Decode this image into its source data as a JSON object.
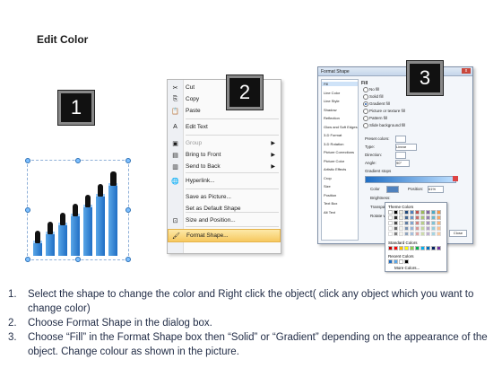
{
  "title": "Edit Color",
  "badges": [
    "1",
    "2",
    "3"
  ],
  "context_menu": {
    "items": [
      {
        "label": "Cut",
        "icon": "scissors-icon",
        "glyph": "✂",
        "disabled": false,
        "submenu": false
      },
      {
        "label": "Copy",
        "icon": "copy-icon",
        "glyph": "⎘",
        "disabled": false,
        "submenu": false
      },
      {
        "label": "Paste",
        "icon": "paste-icon",
        "glyph": "📋",
        "disabled": false,
        "submenu": false
      },
      {
        "label": "Edit Text",
        "icon": "edit-text-icon",
        "glyph": "A",
        "disabled": false,
        "submenu": false
      },
      {
        "label": "Group",
        "icon": "group-icon",
        "glyph": "▣",
        "disabled": true,
        "submenu": true
      },
      {
        "label": "Bring to Front",
        "icon": "bring-to-front-icon",
        "glyph": "▤",
        "disabled": false,
        "submenu": true
      },
      {
        "label": "Send to Back",
        "icon": "send-to-back-icon",
        "glyph": "▥",
        "disabled": false,
        "submenu": true
      },
      {
        "label": "Hyperlink...",
        "icon": "hyperlink-icon",
        "glyph": "🌐",
        "disabled": false,
        "submenu": false
      },
      {
        "label": "Save as Picture...",
        "icon": "",
        "glyph": "",
        "disabled": false,
        "submenu": false
      },
      {
        "label": "Set as Default Shape",
        "icon": "",
        "glyph": "",
        "disabled": false,
        "submenu": false
      },
      {
        "label": "Size and Position...",
        "icon": "size-position-icon",
        "glyph": "⊡",
        "disabled": false,
        "submenu": false
      },
      {
        "label": "Format Shape...",
        "icon": "format-shape-icon",
        "glyph": "🖌",
        "disabled": false,
        "submenu": false,
        "highlighted": true
      }
    ]
  },
  "dialog": {
    "title": "Format Shape",
    "close": "x",
    "categories": [
      "Fill",
      "Line Color",
      "Line Style",
      "Shadow",
      "Reflection",
      "Glow and Soft Edges",
      "3-D Format",
      "3-D Rotation",
      "Picture Corrections",
      "Picture Color",
      "Artistic Effects",
      "Crop",
      "Size",
      "Position",
      "Text Box",
      "Alt Text"
    ],
    "section": "Fill",
    "fill_options": [
      "No fill",
      "Solid fill",
      "Gradient fill",
      "Picture or texture fill",
      "Pattern fill",
      "Slide background fill"
    ],
    "selected_fill": "Gradient fill",
    "preset_label": "Preset colors:",
    "type_label": "Type:",
    "type_value": "Linear",
    "direction_label": "Direction:",
    "angle_label": "Angle:",
    "angle_value": "90°",
    "stops_label": "Gradient stops",
    "color_label": "Color",
    "position_label": "Position:",
    "position_value": "61%",
    "brightness_label": "Brightness:",
    "transparency_label": "Transparency:",
    "rotate_label": "Rotate with shape",
    "close_button": "Close"
  },
  "palette": {
    "theme_label": "Theme Colors",
    "standard_label": "Standard Colors",
    "recent_label": "Recent Colors",
    "more_label": "More Colors...",
    "theme_row": [
      "#ffffff",
      "#000000",
      "#eeece1",
      "#1f497d",
      "#4f81bd",
      "#c0504d",
      "#9bbb59",
      "#8064a2",
      "#4bacc6",
      "#f79646"
    ],
    "standard_row": [
      "#c00000",
      "#ff0000",
      "#ffc000",
      "#ffff00",
      "#92d050",
      "#00b050",
      "#00b0f0",
      "#0070c0",
      "#002060",
      "#7030a0"
    ],
    "recent_row": [
      "#1f6ec4",
      "#5aa7e8",
      "#ffffff",
      "#000000"
    ]
  },
  "steps": [
    {
      "n": "1.",
      "text": "Select the shape to change the color and Right click the object( click any object which you want to change color)"
    },
    {
      "n": "2.",
      "text": "Choose Format Shape in the dialog box."
    },
    {
      "n": "3.",
      "text": "Choose “Fill” in the Format Shape box then “Solid” or “Gradient” depending on the appearance of the object. Change colour as shown in the picture."
    }
  ]
}
